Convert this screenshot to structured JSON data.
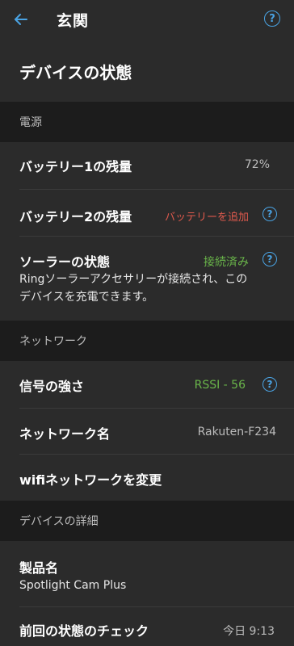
{
  "header": {
    "title": "玄関",
    "back_icon": "arrow-left-icon",
    "help_icon": "help-circle-icon"
  },
  "page_heading": "デバイスの状態",
  "sections": {
    "power": {
      "title": "電源",
      "battery1": {
        "label": "バッテリー1の残量",
        "value": "72%"
      },
      "battery2": {
        "label": "バッテリー2の残量",
        "value": "バッテリーを追加"
      },
      "solar": {
        "label": "ソーラーの状態",
        "value": "接続済み",
        "desc_line1": "Ringソーラーアクセサリーが接続され、この",
        "desc_line2": "デバイスを充電できます。"
      }
    },
    "network": {
      "title": "ネットワーク",
      "signal": {
        "label": "信号の強さ",
        "value": "RSSI - 56"
      },
      "network_name": {
        "label": "ネットワーク名",
        "value": "Rakuten-F234"
      },
      "change_wifi": {
        "label": "wifiネットワークを変更"
      }
    },
    "device_details": {
      "title": "デバイスの詳細",
      "product": {
        "label": "製品名",
        "value": "Spotlight Cam Plus"
      },
      "last_check": {
        "label": "前回の状態のチェック",
        "value": "今日 9:13"
      }
    }
  },
  "colors": {
    "background": "#2b2b2b",
    "section_bg": "#1c1c1c",
    "accent_blue": "#4aa3e3",
    "status_green": "#6ab64a",
    "status_red": "#e05a4d"
  }
}
